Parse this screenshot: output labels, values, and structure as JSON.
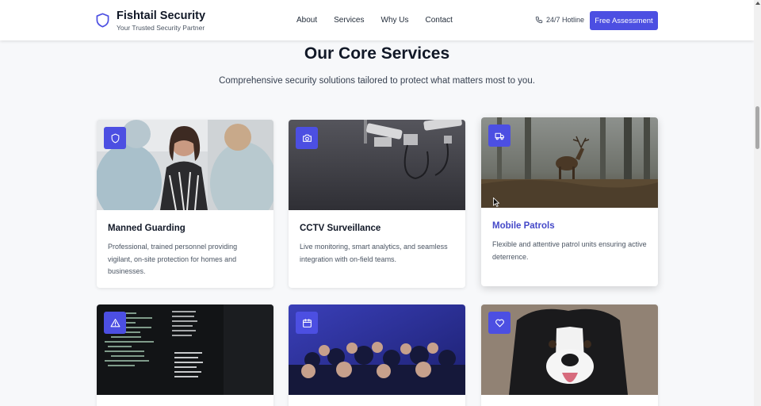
{
  "brand": {
    "name": "Fishtail Security",
    "tagline": "Your Trusted Security Partner",
    "logo_icon": "shield-icon"
  },
  "nav": {
    "items": [
      "About",
      "Services",
      "Why Us",
      "Contact"
    ]
  },
  "hotline": {
    "label": "24/7 Hotline",
    "icon": "phone-icon"
  },
  "cta": {
    "label": "Free Assessment"
  },
  "section": {
    "title": "Our Core Services",
    "subtitle": "Comprehensive security solutions tailored to protect what matters most to you."
  },
  "services": [
    {
      "title": "Manned Guarding",
      "description": "Professional, trained personnel providing vigilant, on-site protection for homes and businesses.",
      "icon": "shield-icon",
      "image": "people-meeting"
    },
    {
      "title": "CCTV Surveillance",
      "description": "Live monitoring, smart analytics, and seamless integration with on-field teams.",
      "icon": "camera-icon",
      "image": "cctv-cameras"
    },
    {
      "title": "Mobile Patrols",
      "description": "Flexible and attentive patrol units ensuring active deterrence.",
      "icon": "truck-icon",
      "image": "deer-in-forest"
    },
    {
      "title": "",
      "description": "",
      "icon": "alert-triangle-icon",
      "image": "code-terminal"
    },
    {
      "title": "",
      "description": "",
      "icon": "calendar-icon",
      "image": "audience-event"
    },
    {
      "title": "",
      "description": "",
      "icon": "heart-icon",
      "image": "dog"
    }
  ],
  "colors": {
    "accent": "#4c4fe2",
    "accent_text": "#4448c8",
    "background": "#f7f8fa"
  }
}
